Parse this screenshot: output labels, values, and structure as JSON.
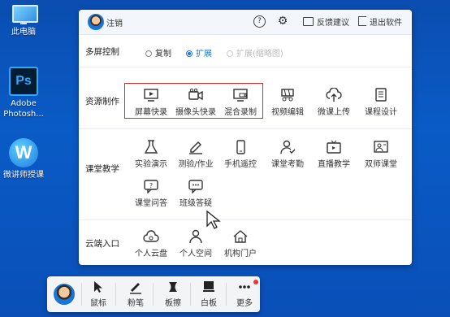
{
  "desktop": {
    "icons": [
      {
        "label": "此电脑",
        "icon": "computer-icon"
      },
      {
        "label": "Adobe Photosh...",
        "icon": "photoshop-icon"
      },
      {
        "label": "微讲师授课",
        "icon": "weijiangshi-icon"
      }
    ]
  },
  "topbar": {
    "logout": "注销",
    "help": "?",
    "feedback": "反馈建议",
    "quit": "退出软件"
  },
  "multiscreen": {
    "label": "多屏控制",
    "options": [
      {
        "label": "复制",
        "state": "unselected"
      },
      {
        "label": "扩展",
        "state": "selected"
      },
      {
        "label": "扩展(缩略图)",
        "state": "disabled"
      }
    ]
  },
  "resources": {
    "label": "资源制作",
    "items": [
      {
        "label": "屏幕快录",
        "icon": "screen-record-icon"
      },
      {
        "label": "摄像头快录",
        "icon": "camera-record-icon"
      },
      {
        "label": "混合录制",
        "icon": "mixed-record-icon"
      },
      {
        "label": "视频编辑",
        "icon": "video-edit-icon"
      },
      {
        "label": "微课上传",
        "icon": "cloud-upload-icon"
      },
      {
        "label": "课程设计",
        "icon": "course-design-icon"
      }
    ]
  },
  "classroom": {
    "label": "课堂教学",
    "items": [
      {
        "label": "实验演示",
        "icon": "flask-icon"
      },
      {
        "label": "测验/作业",
        "icon": "pencil-icon"
      },
      {
        "label": "手机遥控",
        "icon": "phone-icon"
      },
      {
        "label": "课堂考勤",
        "icon": "attendance-icon"
      },
      {
        "label": "直播教学",
        "icon": "tv-icon"
      },
      {
        "label": "双师课堂",
        "icon": "dual-teacher-icon"
      },
      {
        "label": "课堂问答",
        "icon": "qa-icon"
      },
      {
        "label": "班级答疑",
        "icon": "chat-icon"
      }
    ]
  },
  "cloud": {
    "label": "云端入口",
    "items": [
      {
        "label": "个人云盘",
        "icon": "cloud-disk-icon"
      },
      {
        "label": "个人空间",
        "icon": "person-icon"
      },
      {
        "label": "机构门户",
        "icon": "home-icon"
      }
    ]
  },
  "toolbar": {
    "items": [
      {
        "label": "鼠标",
        "icon": "mouse-pointer-icon"
      },
      {
        "label": "粉笔",
        "icon": "chalk-icon"
      },
      {
        "label": "板擦",
        "icon": "eraser-icon"
      },
      {
        "label": "白板",
        "icon": "whiteboard-icon"
      },
      {
        "label": "更多",
        "icon": "more-icon"
      }
    ]
  },
  "colors": {
    "accent": "#1a75d8",
    "highlight": "#e0262b",
    "desktop": "#0a5bc6"
  }
}
